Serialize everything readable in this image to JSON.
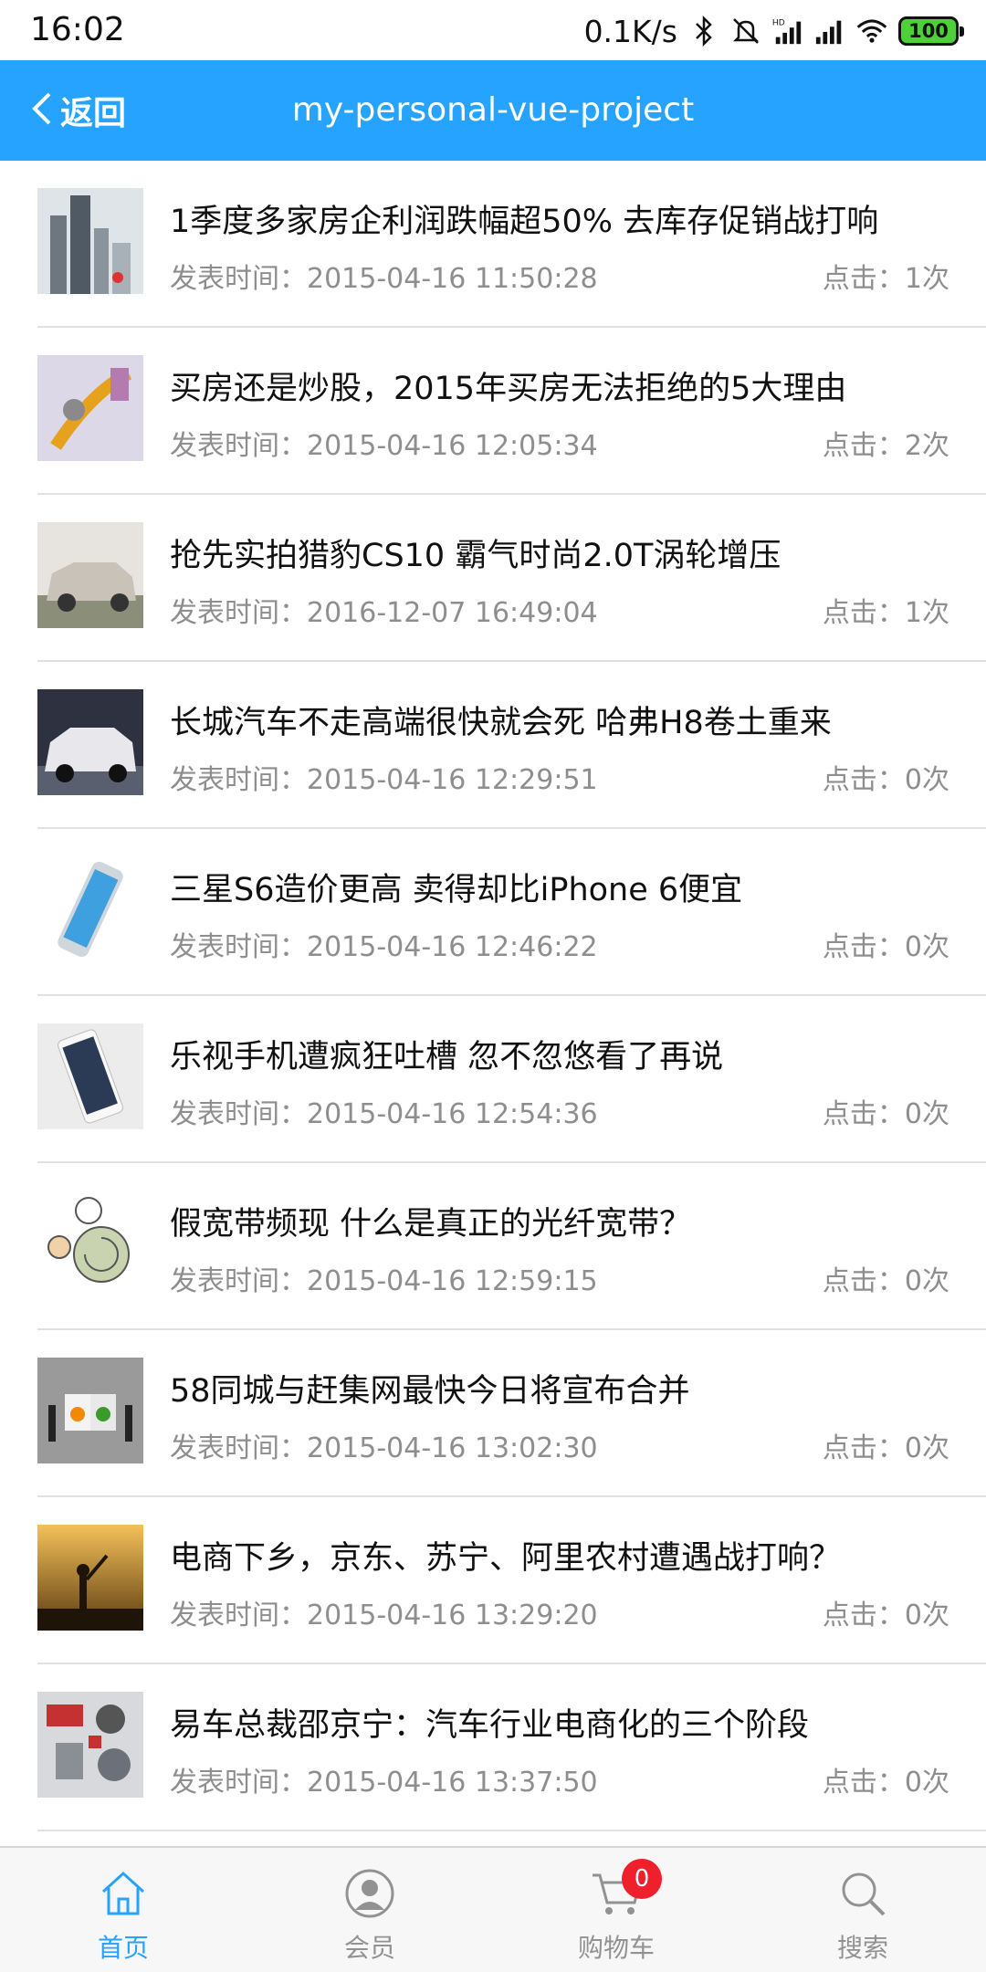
{
  "status_bar": {
    "time": "16:02",
    "net_speed": "0.1K/s",
    "battery": "100",
    "icons": [
      "bluetooth-icon",
      "mute-icon",
      "hd-signal-icon",
      "signal-icon",
      "wifi-icon",
      "battery-icon"
    ]
  },
  "header": {
    "back_label": "返回",
    "title": "my-personal-vue-project",
    "color": "#26a2ff"
  },
  "news": [
    {
      "title": "1季度多家房企利润跌幅超50% 去库存促销战打响",
      "time": "发表时间：2015-04-16 11:50:28",
      "clicks": "点击：1次",
      "thumb": "buildings"
    },
    {
      "title": "买房还是炒股，2015年买房无法拒绝的5大理由",
      "time": "发表时间：2015-04-16 12:05:34",
      "clicks": "点击：2次",
      "thumb": "cartoon-dollar"
    },
    {
      "title": "抢先实拍猎豹CS10 霸气时尚2.0T涡轮增压",
      "time": "发表时间：2016-12-07 16:49:04",
      "clicks": "点击：1次",
      "thumb": "suv-silver"
    },
    {
      "title": "长城汽车不走高端很快就会死 哈弗H8卷土重来",
      "time": "发表时间：2015-04-16 12:29:51",
      "clicks": "点击：0次",
      "thumb": "suv-dark"
    },
    {
      "title": "三星S6造价更高 卖得却比iPhone 6便宜",
      "time": "发表时间：2015-04-16 12:46:22",
      "clicks": "点击：0次",
      "thumb": "phone-curved"
    },
    {
      "title": "乐视手机遭疯狂吐槽 忽不忽悠看了再说",
      "time": "发表时间：2015-04-16 12:54:36",
      "clicks": "点击：0次",
      "thumb": "phone-white"
    },
    {
      "title": "假宽带频现 什么是真正的光纤宽带？",
      "time": "发表时间：2015-04-16 12:59:15",
      "clicks": "点击：0次",
      "thumb": "cartoon-snail"
    },
    {
      "title": "58同城与赶集网最快今日将宣布合并",
      "time": "发表时间：2015-04-16 13:02:30",
      "clicks": "点击：0次",
      "thumb": "puzzle"
    },
    {
      "title": "电商下乡，京东、苏宁、阿里农村遭遇战打响？",
      "time": "发表时间：2015-04-16 13:29:20",
      "clicks": "点击：0次",
      "thumb": "sunset"
    },
    {
      "title": "易车总裁邵京宁：汽车行业电商化的三个阶段",
      "time": "发表时间：2015-04-16 13:37:50",
      "clicks": "点击：0次",
      "thumb": "car-parts"
    }
  ],
  "tabbar": {
    "tabs": [
      {
        "label": "首页",
        "icon": "home-icon",
        "active": true
      },
      {
        "label": "会员",
        "icon": "member-icon",
        "active": false
      },
      {
        "label": "购物车",
        "icon": "cart-icon",
        "active": false,
        "badge": "0"
      },
      {
        "label": "搜索",
        "icon": "search-icon",
        "active": false
      }
    ]
  }
}
